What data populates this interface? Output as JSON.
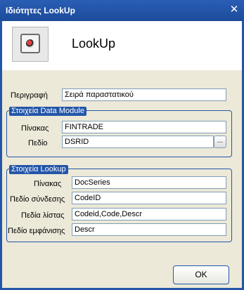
{
  "window": {
    "title": "Ιδιότητες LookUp",
    "close_label": "✕"
  },
  "header": {
    "icon": "lookup-control-icon",
    "title": "LookUp"
  },
  "description": {
    "label": "Περιγραφή",
    "value": "Σειρά παραστατικού"
  },
  "data_module": {
    "legend": "Στοιχεία Data Module",
    "table_label": "Πίνακας",
    "table_value": "FINTRADE",
    "field_label": "Πεδίο",
    "field_value": "DSRID",
    "browse_label": "..."
  },
  "lookup": {
    "legend": "Στοιχεία Lookup",
    "table_label": "Πίνακας",
    "table_value": "DocSeries",
    "link_field_label": "Πεδίο σύνδεσης",
    "link_field_value": "CodeID",
    "list_fields_label": "Πεδία λίστας",
    "list_fields_value": "Codeid,Code,Descr",
    "display_field_label": "Πεδίο εμφάνισης",
    "display_field_value": "Descr"
  },
  "buttons": {
    "ok_label": "OK"
  },
  "colors": {
    "titlebar": "#2356a8",
    "dialog_bg": "#ece9d8",
    "field_border": "#7f9db9"
  }
}
